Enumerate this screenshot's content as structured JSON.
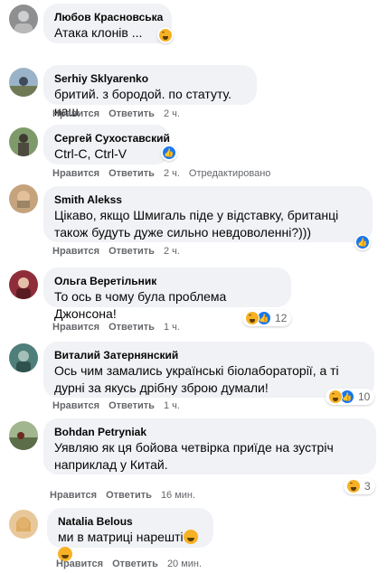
{
  "actions": {
    "like": "Нравится",
    "reply": "Ответить",
    "edited": "Отредактировано"
  },
  "comments": [
    {
      "author": "Любов Красновська",
      "text": "Атака клонів ...",
      "time": "",
      "reaction_count": ""
    },
    {
      "author": "Serhiy Sklyarenko",
      "text": "бритий. з бородой. по статуту. наш",
      "time": "2 ч.",
      "reaction_count": ""
    },
    {
      "author": "Сергей Сухоставский",
      "text": "Ctrl-C, Ctrl-V",
      "time": "2 ч.",
      "reaction_count": ""
    },
    {
      "author": "Smith Alekss",
      "text": "Цікаво, якщо Шмигаль піде у відставку, британці також будуть дуже сильно невдоволенні?)))",
      "time": "2 ч.",
      "reaction_count": ""
    },
    {
      "author": "Ольга Веретільник",
      "text": "То ось в чому була проблема Джонсона!",
      "time": "1 ч.",
      "reaction_count": "12"
    },
    {
      "author": "Виталий Затернянский",
      "text": "Ось чим замались українські біолабораторії, а ті дурні за якусь дрібну зброю думали!",
      "time": "1 ч.",
      "reaction_count": "10"
    },
    {
      "author": "Bohdan Petryniak",
      "text": "Уявляю як ця бойова четвірка приїде на зустріч наприклад у Китай.",
      "time": "16 мин.",
      "reaction_count": "3"
    },
    {
      "author": "Natalia Belous",
      "text": "ми в матриці нарешті",
      "time": "20 мин.",
      "reaction_count": ""
    }
  ],
  "colors": {
    "bubble": "#f0f2f5",
    "meta": "#65676b",
    "like_blue": "#1877f2",
    "haha_yellow": "#f7b125"
  }
}
